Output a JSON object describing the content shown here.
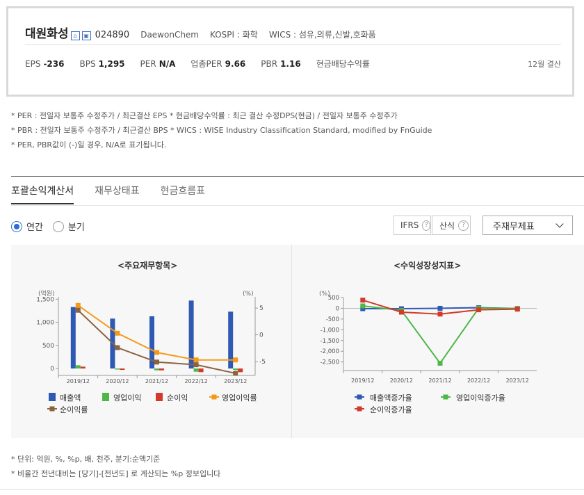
{
  "corp": {
    "name": "대원화성",
    "code": "024890",
    "eng_name": "DaewonChem",
    "market": "KOSPI : 화학",
    "wics": "WICS : 섬유,의류,신발,호화품",
    "fiscal_month": "12월 결산"
  },
  "stats": [
    {
      "label": "EPS",
      "value": "-236"
    },
    {
      "label": "BPS",
      "value": "1,295"
    },
    {
      "label": "PER",
      "value": "N/A"
    },
    {
      "label": "업종PER",
      "value": "9.66"
    },
    {
      "label": "PBR",
      "value": "1.16"
    },
    {
      "label": "현금배당수익률",
      "value": ""
    }
  ],
  "notes": [
    "* PER : 전일자 보통주 수정주가 / 최근결산 EPS * 현금배당수익률 : 최근 결산 수정DPS(현금) / 전일자 보통주 수정주가",
    "* PBR : 전일자 보통주 수정주가 / 최근결산 BPS * WICS : WISE Industry Classification Standard, modified by FnGuide",
    "* PER, PBR값이 (-)일 경우, N/A로 표기됩니다."
  ],
  "tabs": [
    "포괄손익계산서",
    "재무상태표",
    "현금흐름표"
  ],
  "period": {
    "options": [
      "연간",
      "분기"
    ],
    "selected": "연간"
  },
  "controls": {
    "ifrs": "IFRS",
    "calc": "산식",
    "help": "?",
    "select_value": "주재무제표"
  },
  "chart_data": [
    {
      "type": "bar",
      "title": "<주요재무항목>",
      "y_left_unit": "(억원)",
      "y_right_unit": "(%)",
      "categories": [
        "2019/12",
        "2020/12",
        "2021/12",
        "2022/12",
        "2023/12"
      ],
      "ylim_left": [
        -150,
        1550
      ],
      "ylim_right": [
        -7.6,
        7.1
      ],
      "left_ticks": [
        "1,500",
        "1,000",
        "500",
        "0"
      ],
      "right_ticks": [
        "5",
        "0",
        "-5"
      ],
      "series": [
        {
          "name": "매출액",
          "axis": "left",
          "kind": "bar",
          "color": "#2f5ab4",
          "values": [
            1330,
            1080,
            1130,
            1470,
            1230
          ]
        },
        {
          "name": "영업이익",
          "axis": "left",
          "kind": "bar",
          "color": "#4cb848",
          "values": [
            70,
            0,
            -40,
            -70,
            -30
          ]
        },
        {
          "name": "순이익",
          "axis": "left",
          "kind": "bar",
          "color": "#d23b2b",
          "values": [
            40,
            -30,
            -40,
            -80,
            -80
          ]
        },
        {
          "name": "영업이익률",
          "axis": "right",
          "kind": "line",
          "color": "#f39a1c",
          "values": [
            5.5,
            0.3,
            -3.3,
            -4.7,
            -4.7
          ]
        },
        {
          "name": "순이익률",
          "axis": "right",
          "kind": "line",
          "color": "#8b6340",
          "values": [
            4.6,
            -2.4,
            -5.1,
            -5.6,
            -7.2
          ]
        }
      ]
    },
    {
      "type": "line",
      "title": "<수익성장성지표>",
      "y_unit": "(%)",
      "categories": [
        "2019/12",
        "2020/12",
        "2021/12",
        "2022/12",
        "2023/12"
      ],
      "ylim": [
        -2900,
        500
      ],
      "ticks": [
        "500",
        "0",
        "-500",
        "-1,000",
        "-1,500",
        "-2,000",
        "-2,500"
      ],
      "series": [
        {
          "name": "매출액증가율",
          "color": "#2f5ab4",
          "values": [
            -20,
            -20,
            0,
            30,
            -10
          ]
        },
        {
          "name": "영업이익증가율",
          "color": "#4cb848",
          "values": [
            110,
            -100,
            -2560,
            10,
            -10
          ]
        },
        {
          "name": "순이익증가율",
          "color": "#d23b2b",
          "values": [
            380,
            -180,
            -270,
            -70,
            -40
          ]
        }
      ]
    }
  ],
  "footer": [
    "* 단위: 억원, %, %p, 배, 천주, 분기:순액기준",
    "* 비율간 전년대비는 [당기]-[전년도] 로 계산되는 %p 정보입니다"
  ]
}
